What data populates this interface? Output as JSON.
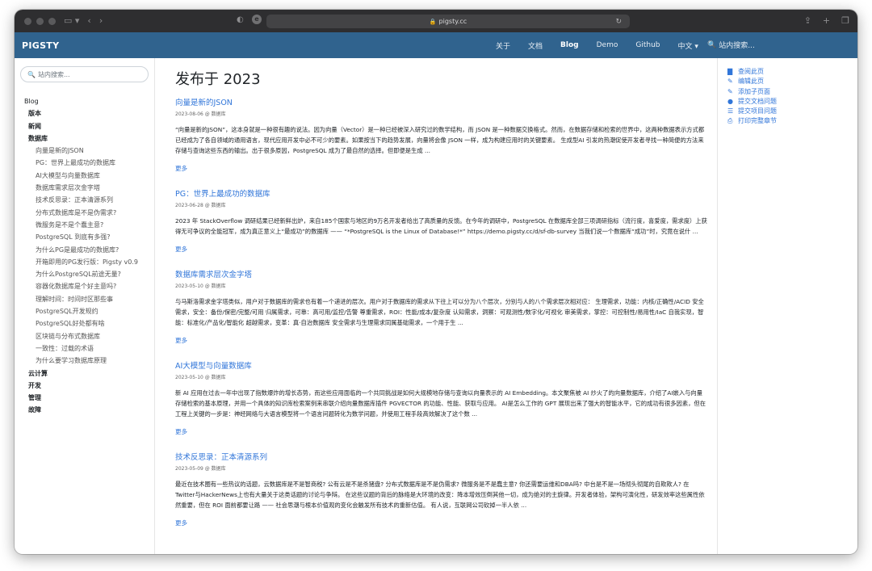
{
  "browser": {
    "url": "pigsty.cc"
  },
  "navbar": {
    "brand": "PIGSTY",
    "links": [
      {
        "label": "关于",
        "active": false
      },
      {
        "label": "文档",
        "active": false
      },
      {
        "label": "Blog",
        "active": true
      },
      {
        "label": "Demo",
        "active": false
      },
      {
        "label": "Github",
        "active": false
      },
      {
        "label": "中文 ▾",
        "active": false
      }
    ],
    "search_label": "站内搜索..."
  },
  "sidebar": {
    "search_placeholder": "站内搜索...",
    "root": "Blog",
    "sections_before": [
      "版本",
      "新闻",
      "数据库"
    ],
    "db_items": [
      "向量是新的JSON",
      "PG：世界上最成功的数据库",
      "AI大模型与向量数据库",
      "数据库需求层次金字塔",
      "技术反思录：正本清源系列",
      "分布式数据库是不是伪需求?",
      "微服务是不是个蠢主意?",
      "PostgreSQL 到底有多强?",
      "为什么PG是最成功的数据库?",
      "开箱即用的PG发行版：Pigsty v0.9",
      "为什么PostgreSQL前途无量?",
      "容器化数据库是个好主意吗?",
      "理解时间：时间时区那些事",
      "PostgreSQL开发规约",
      "PostgreSQL好处都有啥",
      "区块链与分布式数据库",
      "一致性：过载的术语",
      "为什么要学习数据库原理"
    ],
    "sections_after": [
      "云计算",
      "开发",
      "管理",
      "故障"
    ]
  },
  "main": {
    "title": "发布于 2023",
    "more_label": "更多",
    "posts": [
      {
        "title": "向量是新的JSON",
        "meta": "2023-08-06 @ 数据库",
        "excerpt": "“向量是新的JSON”，这本身就是一种很有趣的说法。因为向量（Vector）是一种已经被深入研究过的数学结构，而 JSON 是一种数据交换格式。然而，在数据存储和检索的世界中，这两种数据表示方式都已经成为了各自领域的通用语言，现代应用开发中必不可少的要素。如果按当下的趋势发展，向量将会像 JSON 一样，成为构建应用时的关键要素。 生成型AI 引发的热潮促使开发者寻找一种简便的方法来存储与查询这些东西的输出。出于很多原因，PostgreSQL 成为了最自然的选择。但即便是生成 ..."
      },
      {
        "title": "PG：世界上最成功的数据库",
        "meta": "2023-06-28 @ 数据库",
        "excerpt": "2023 年 StackOverflow 调研结果已经新鲜出炉，来自185个国家与地区的9万名开发者给出了高质量的反馈。在今年的调研中，PostgreSQL 在数据库全部三项调研指标（流行度，喜爱度，需求度）上获得无可争议的全能冠军，成为真正意义上“最成功”的数据库 —— “*PostgreSQL is the Linux of Database!*” https://demo.pigsty.cc/d/sf-db-survey 当我们说一个数据库“成功”时，究竟在说什 ..."
      },
      {
        "title": "数据库需求层次金字塔",
        "meta": "2023-05-10 @ 数据库",
        "excerpt": "与马斯洛需求金字塔类似，用户对于数据库的需求也有着一个递进的层次。用户对于数据库的需求从下往上可以分为八个层次，分别与人的八个需求层次相对应： 生理需求，功能：内核/正确性/ACID 安全需求，安全：备份/保密/完整/可用 归属需求，可靠：高可用/监控/告警 尊重需求，ROI：性能/成本/复杂度 认知需求，洞察：可观测性/数字化/可视化 审美需求，掌控：可控制性/易用性/IaC 自我实现，智能：标准化/产品化/智能化 超越需求，变革：真·自治数据库 安全需求与生理需求同属基础需求，一个用于生 ..."
      },
      {
        "title": "AI大模型与向量数据库",
        "meta": "2023-05-10 @ 数据库",
        "excerpt": "新 AI 应用在过去一年中出现了指数爆炸的增长态势，而这些应用面临的一个共同挑战是如何大规模地存储与查询以向量表示的 AI Embedding。本文聚焦被 AI 炒火了的向量数据库，介绍了AI嵌入与向量存储检索的基本原理，并用一个具体的知识库检索案例来串联介绍向量数据库插件 PGVECTOR 的功能、性能、获取与应用。 AI是怎么工作的 GPT 展现出来了强大的智能水平，它的成功有很多因素，但在工程上关键的一步是：神经网络与大语言模型将一个语言问题转化为数学问题，并使用工程手段高效解决了这个数 ..."
      },
      {
        "title": "技术反思录：正本清源系列",
        "meta": "2023-05-09 @ 数据库",
        "excerpt": "最近在技术圈有一些热议的话题，云数据库是不是智商税? 公有云是不是杀猪盘? 分布式数据库是不是伪需求? 微服务是不是蠢主意? 你还需要运维和DBA吗? 中台是不是一场彻头彻尾的自欺欺人? 在Twitter与HackerNews上也有大量关于这类话题的讨论与争辩。 在这些议题的背后的脉络是大环境的改变：降本增效压倒其他一切，成为绝对的主旋律。开发者体验，架构可演化性，研发效率这些属性依然重要，但在 ROI 面前都要让路 —— 社会思潮与根本价值观的变化会触发所有技术的重新估值。 有人说，互联网公司砍掉一半人依 ..."
      }
    ]
  },
  "toc": {
    "links": [
      {
        "icon": "file-icon",
        "glyph": "▇",
        "label": "查阅此页"
      },
      {
        "icon": "edit-icon",
        "glyph": "✎",
        "label": "编辑此页"
      },
      {
        "icon": "add-page-icon",
        "glyph": "✎",
        "label": "添加子页面"
      },
      {
        "icon": "github-icon",
        "glyph": "●",
        "label": "提交文档问题"
      },
      {
        "icon": "list-icon",
        "glyph": "☰",
        "label": "提交项目问题"
      },
      {
        "icon": "print-icon",
        "glyph": "⎙",
        "label": "打印完整章节"
      }
    ]
  }
}
